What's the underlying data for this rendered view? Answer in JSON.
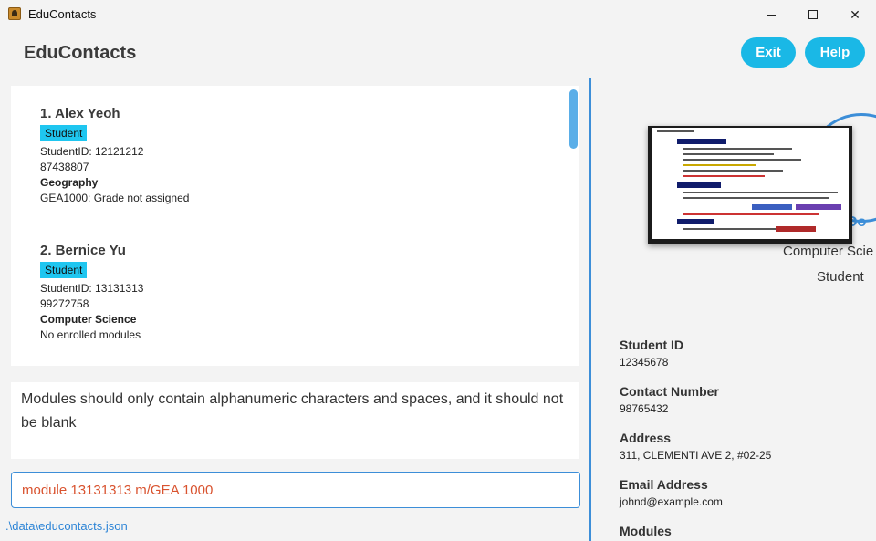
{
  "window": {
    "title": "EduContacts"
  },
  "header": {
    "app_name": "EduContacts",
    "exit_label": "Exit",
    "help_label": "Help"
  },
  "contacts": [
    {
      "index_name": "1.  Alex Yeoh",
      "role": "Student",
      "student_id": "StudentID: 12121212",
      "phone": "87438807",
      "course": "Geography",
      "module_info": "GEA1000: Grade not assigned"
    },
    {
      "index_name": "2.  Bernice Yu",
      "role": "Student",
      "student_id": "StudentID: 13131313",
      "phone": "99272758",
      "course": "Computer Science",
      "module_info": "No enrolled modules"
    }
  ],
  "result_message": "Modules should only contain alphanumeric characters and spaces, and it should not be blank",
  "command_input": "module 13131313 m/GEA 1000",
  "status_path": ".\\data\\educontacts.json",
  "profile": {
    "name_partial": "Do",
    "faculty": "Computer Scie",
    "role": "Student",
    "student_id_label": "Student ID",
    "student_id": "12345678",
    "contact_label": "Contact Number",
    "contact": "98765432",
    "address_label": "Address",
    "address": "311, CLEMENTI AVE 2, #02-25",
    "email_label": "Email Address",
    "email": "johnd@example.com",
    "modules_label": "Modules"
  },
  "colors": {
    "accent": "#1ab8e6",
    "tag": "#1fc6f0",
    "link": "#2c84d6",
    "error_text": "#d9532f",
    "divider": "#3c8ed8"
  }
}
